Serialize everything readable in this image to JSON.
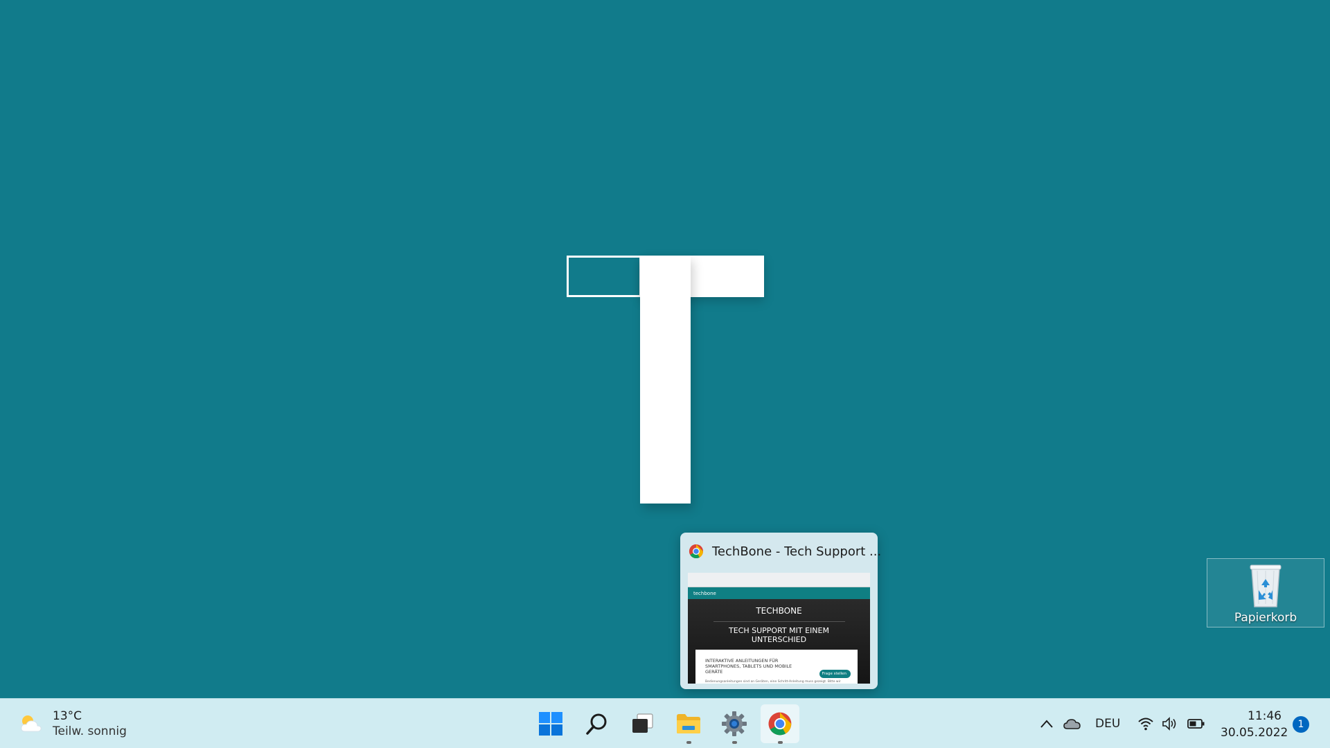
{
  "desktop": {
    "background_color": "#117b8b",
    "recycle_bin": {
      "label": "Papierkorb",
      "icon": "recycle-bin-icon"
    }
  },
  "preview": {
    "title": "TechBone - Tech Support ...",
    "icon": "chrome-icon",
    "thumbnail": {
      "site_logo": "techbone",
      "heading": "TECHBONE",
      "subheading": "TECH SUPPORT MIT EINEM UNTERSCHIED",
      "card_text": "INTERAKTIVE ANLEITUNGEN FÜR SMARTPHONES, TABLETS UND MOBILE GERÄTE",
      "ask_button": "Frage stellen",
      "footer_text": "Bedienungsanleitungen sind an Geräten, eine Schritt-Anleitung muss gezeigt. Bitte wir"
    }
  },
  "taskbar": {
    "weather": {
      "temperature": "13°C",
      "condition": "Teilw. sonnig",
      "icon": "partly-sunny-icon"
    },
    "apps": [
      {
        "name": "start",
        "icon": "windows-start-icon"
      },
      {
        "name": "search",
        "icon": "search-icon"
      },
      {
        "name": "task-view",
        "icon": "task-view-icon"
      },
      {
        "name": "file-explorer",
        "icon": "folder-icon",
        "running": true
      },
      {
        "name": "settings",
        "icon": "gear-icon",
        "running": true
      },
      {
        "name": "chrome",
        "icon": "chrome-icon",
        "running": true,
        "active": true
      }
    ],
    "tray": {
      "language": "DEU",
      "icons": [
        "chevron-up-icon",
        "onedrive-cloud-icon",
        "wifi-icon",
        "speaker-icon",
        "battery-icon"
      ]
    },
    "clock": {
      "time": "11:46",
      "date": "30.05.2022"
    },
    "notification_count": "1",
    "accent_color": "#0067c0"
  }
}
